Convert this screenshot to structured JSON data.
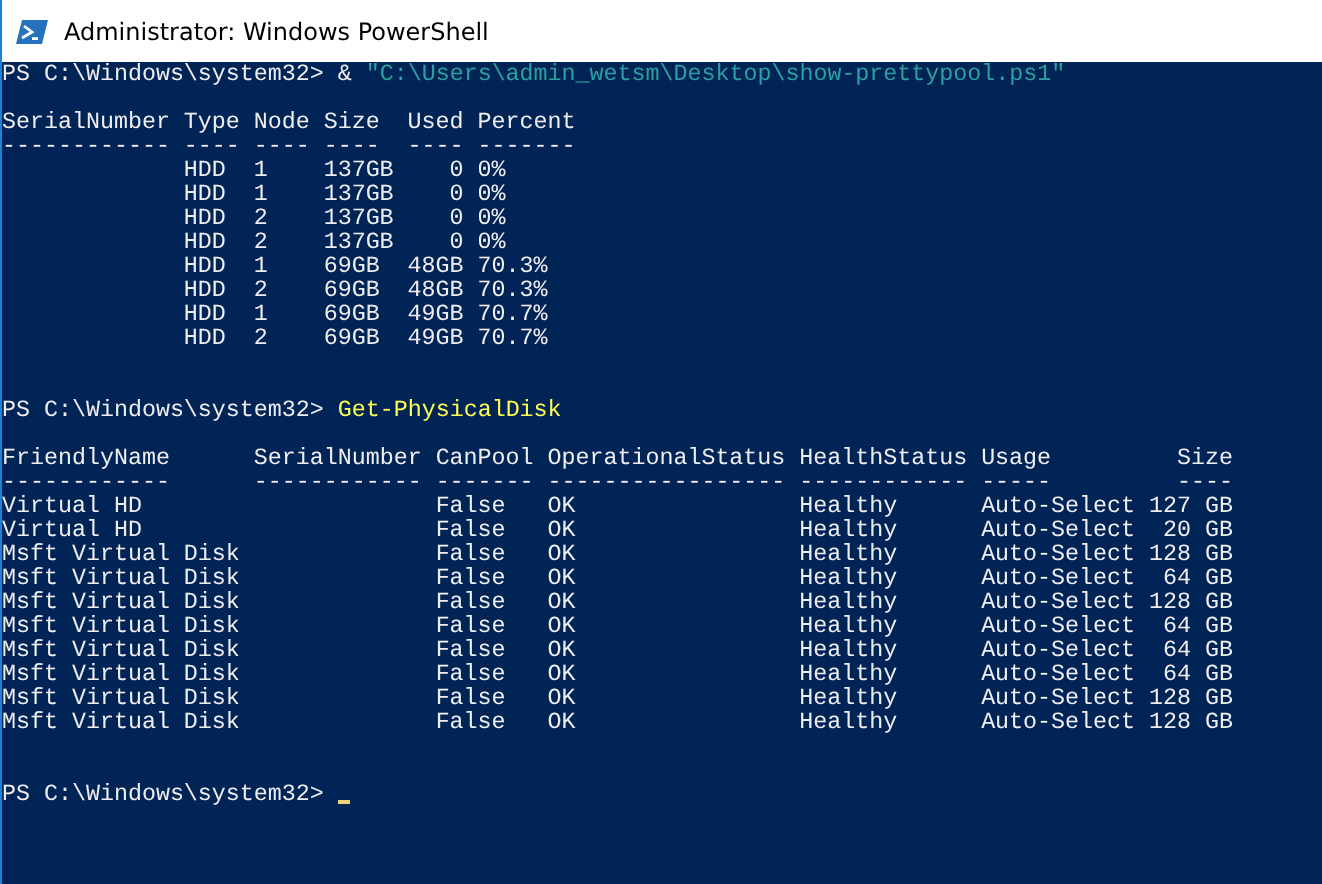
{
  "window": {
    "title": "Administrator: Windows PowerShell"
  },
  "blocks": [
    {
      "kind": "command",
      "prompt": "PS C:\\Windows\\system32>",
      "operator": "&",
      "argument": "\"C:\\Users\\admin_wetsm\\Desktop\\show-prettypool.ps1\""
    },
    {
      "kind": "blank"
    },
    {
      "kind": "table",
      "columns": [
        {
          "label": "SerialNumber",
          "underline": "------------",
          "kind": "text"
        },
        {
          "label": "Type",
          "underline": "----",
          "kind": "text"
        },
        {
          "label": "Node",
          "underline": "----",
          "kind": "text"
        },
        {
          "label": "Size",
          "underline": "----",
          "kind": "text"
        },
        {
          "label": "Used",
          "underline": "----",
          "kind": "number"
        },
        {
          "label": "Percent",
          "underline": "-------",
          "kind": "text"
        }
      ],
      "rows": [
        [
          null,
          "HDD",
          "1",
          "137GB",
          "0",
          "0%"
        ],
        [
          null,
          "HDD",
          "1",
          "137GB",
          "0",
          "0%"
        ],
        [
          null,
          "HDD",
          "2",
          "137GB",
          "0",
          "0%"
        ],
        [
          null,
          "HDD",
          "2",
          "137GB",
          "0",
          "0%"
        ],
        [
          null,
          "HDD",
          "1",
          "69GB",
          "48GB",
          "70.3%"
        ],
        [
          null,
          "HDD",
          "2",
          "69GB",
          "48GB",
          "70.3%"
        ],
        [
          null,
          "HDD",
          "1",
          "69GB",
          "49GB",
          "70.7%"
        ],
        [
          null,
          "HDD",
          "2",
          "69GB",
          "49GB",
          "70.7%"
        ]
      ]
    },
    {
      "kind": "blank"
    },
    {
      "kind": "blank"
    },
    {
      "kind": "command",
      "prompt": "PS C:\\Windows\\system32>",
      "command": "Get-PhysicalDisk"
    },
    {
      "kind": "blank"
    },
    {
      "kind": "table",
      "columns": [
        {
          "label": "FriendlyName",
          "underline": "------------",
          "kind": "text"
        },
        {
          "label": "SerialNumber",
          "underline": "------------",
          "kind": "text"
        },
        {
          "label": "CanPool",
          "underline": "-------",
          "kind": "text"
        },
        {
          "label": "OperationalStatus",
          "underline": "-----------------",
          "kind": "text"
        },
        {
          "label": "HealthStatus",
          "underline": "------------",
          "kind": "text"
        },
        {
          "label": "Usage",
          "underline": "-----",
          "kind": "text"
        },
        {
          "label": "Size",
          "underline": "----",
          "kind": "number"
        }
      ],
      "rows": [
        [
          "Virtual HD",
          null,
          "False",
          "OK",
          "Healthy",
          "Auto-Select",
          "127 GB"
        ],
        [
          "Virtual HD",
          null,
          "False",
          "OK",
          "Healthy",
          "Auto-Select",
          "20 GB"
        ],
        [
          "Msft Virtual Disk",
          null,
          "False",
          "OK",
          "Healthy",
          "Auto-Select",
          "128 GB"
        ],
        [
          "Msft Virtual Disk",
          null,
          "False",
          "OK",
          "Healthy",
          "Auto-Select",
          "64 GB"
        ],
        [
          "Msft Virtual Disk",
          null,
          "False",
          "OK",
          "Healthy",
          "Auto-Select",
          "128 GB"
        ],
        [
          "Msft Virtual Disk",
          null,
          "False",
          "OK",
          "Healthy",
          "Auto-Select",
          "64 GB"
        ],
        [
          "Msft Virtual Disk",
          null,
          "False",
          "OK",
          "Healthy",
          "Auto-Select",
          "64 GB"
        ],
        [
          "Msft Virtual Disk",
          null,
          "False",
          "OK",
          "Healthy",
          "Auto-Select",
          "64 GB"
        ],
        [
          "Msft Virtual Disk",
          null,
          "False",
          "OK",
          "Healthy",
          "Auto-Select",
          "128 GB"
        ],
        [
          "Msft Virtual Disk",
          null,
          "False",
          "OK",
          "Healthy",
          "Auto-Select",
          "128 GB"
        ]
      ]
    },
    {
      "kind": "blank"
    },
    {
      "kind": "blank"
    },
    {
      "kind": "prompt",
      "prompt": "PS C:\\Windows\\system32>"
    }
  ]
}
